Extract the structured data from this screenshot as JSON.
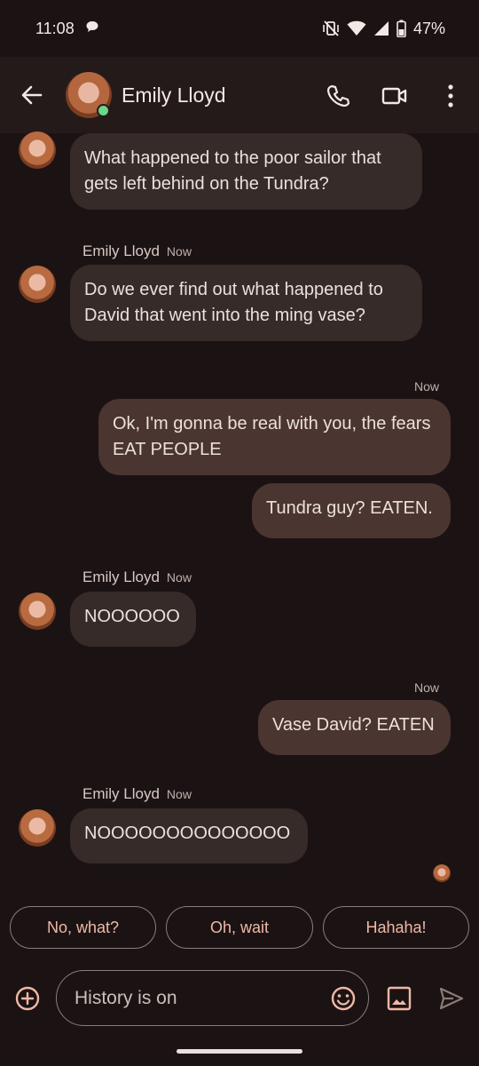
{
  "status_bar": {
    "time": "11:08",
    "battery": "47%"
  },
  "header": {
    "contact_name": "Emily Lloyd"
  },
  "messages": [
    {
      "type": "incoming",
      "text": "What happened to the poor sailor that gets left behind on the Tundra?"
    },
    {
      "type": "incoming",
      "sender": "Emily Lloyd",
      "time": "Now",
      "text": "Do we ever find out what happened to David that went into the ming vase?"
    },
    {
      "type": "outgoing",
      "time": "Now",
      "text": "Ok, I'm gonna be real with you, the fears EAT PEOPLE"
    },
    {
      "type": "outgoing",
      "text": "Tundra guy? EATEN."
    },
    {
      "type": "incoming",
      "sender": "Emily Lloyd",
      "time": "Now",
      "text": "NOOOOOO"
    },
    {
      "type": "outgoing",
      "time": "Now",
      "text": "Vase David? EATEN"
    },
    {
      "type": "incoming",
      "sender": "Emily Lloyd",
      "time": "Now",
      "text": "NOOOOOOOOOOOOOO"
    }
  ],
  "suggestions": [
    "No, what?",
    "Oh, wait",
    "Hahaha!"
  ],
  "composer": {
    "placeholder": "History is on"
  },
  "icons": {
    "status": [
      "chat-notification-icon",
      "vibrate-off-icon",
      "wifi-icon",
      "signal-icon",
      "battery-icon"
    ],
    "header": [
      "back-arrow-icon",
      "phone-icon",
      "video-call-icon",
      "more-options-icon"
    ],
    "composer": [
      "add-icon",
      "emoji-icon",
      "gallery-icon",
      "send-icon"
    ]
  },
  "colors": {
    "accent": "#f0b8a6",
    "incoming_bubble": "#372b2a",
    "outgoing_bubble": "#4b3530",
    "presence": "#6cd68a"
  }
}
